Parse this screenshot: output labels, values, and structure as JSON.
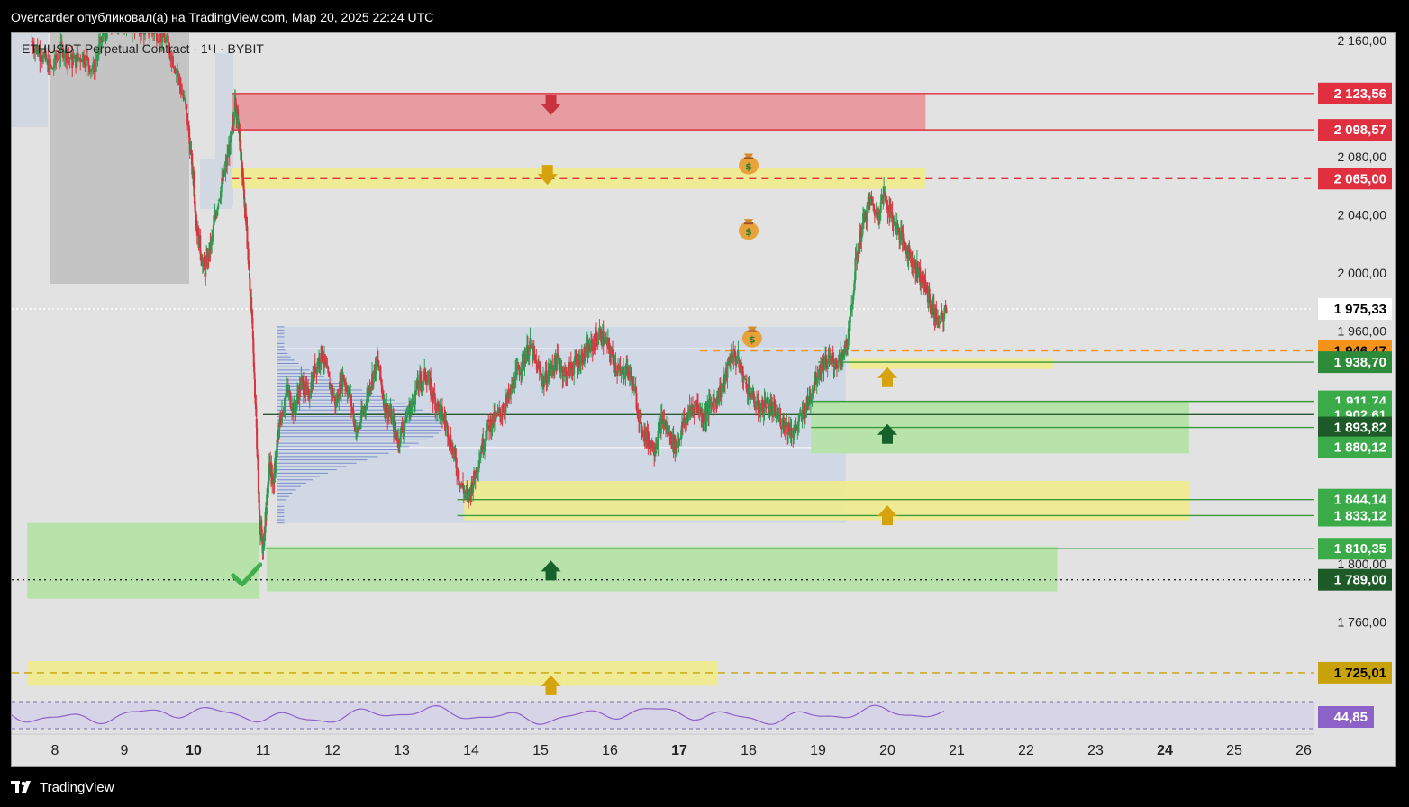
{
  "header": {
    "published_text": "Overcarder опубликовал(а) на TradingView.com, Мар 20, 2025 22:24 UTC"
  },
  "symbol": {
    "title": "ETHUSDT Perpetual Contract · 1Ч · BYBIT"
  },
  "footer": {
    "brand": "TradingView"
  },
  "colors": {
    "background": "#e2e2e2",
    "resistance_zone": "#e8959b",
    "resistance_line": "#e03040",
    "yellow_zone": "#f0ec8c",
    "green_zone": "#b2e3a4",
    "green_line": "#3a9a3c",
    "candle_up": "#2e9a52",
    "candle_down": "#d6343e",
    "rsi_line": "#8d62c8",
    "arrow_red": "#c8333f",
    "arrow_yellow": "#d4a30e",
    "arrow_green": "#17622a"
  },
  "chart_data": {
    "type": "candlestick",
    "symbol": "ETHUSDT Perpetual Contract",
    "timeframe": "1Ч",
    "exchange": "BYBIT",
    "x_ticks": [
      "8",
      "9",
      "10",
      "11",
      "12",
      "13",
      "14",
      "15",
      "16",
      "17",
      "18",
      "19",
      "20",
      "21",
      "22",
      "23",
      "24",
      "25",
      "26"
    ],
    "bold_x_ticks": [
      "10",
      "17",
      "24"
    ],
    "ylim": [
      1700,
      2180
    ],
    "y_ticks": [
      {
        "value": 2160,
        "label": "2 160,00"
      },
      {
        "value": 2080,
        "label": "2 080,00"
      },
      {
        "value": 2040,
        "label": "2 040,00"
      },
      {
        "value": 2000,
        "label": "2 000,00"
      },
      {
        "value": 1960,
        "label": "1 960,00"
      },
      {
        "value": 1800,
        "label": "1 800,00"
      },
      {
        "value": 1760,
        "label": "1 760,00"
      }
    ],
    "price_labels": [
      {
        "value": 2123.56,
        "label": "2 123,56",
        "bg": "#e03040",
        "fg": "#ffffff"
      },
      {
        "value": 2098.57,
        "label": "2 098,57",
        "bg": "#e03040",
        "fg": "#ffffff"
      },
      {
        "value": 2065.0,
        "label": "2 065,00",
        "bg": "#e03040",
        "fg": "#ffffff"
      },
      {
        "value": 1975.33,
        "label": "1 975,33",
        "bg": "#ffffff",
        "fg": "#000000"
      },
      {
        "value": 1946.47,
        "label": "1 946,47",
        "bg": "#f7931a",
        "fg": "#000000"
      },
      {
        "value": 1938.7,
        "label": "1 938,70",
        "bg": "#2e8b3a",
        "fg": "#ffffff"
      },
      {
        "value": 1911.74,
        "label": "1 911,74",
        "bg": "#3aab48",
        "fg": "#ffffff"
      },
      {
        "value": 1902.61,
        "label": "1 902,61",
        "bg": "#3aab48",
        "fg": "#ffffff"
      },
      {
        "value": 1893.82,
        "label": "1 893,82",
        "bg": "#1d5a27",
        "fg": "#ffffff"
      },
      {
        "value": 1880.12,
        "label": "1 880,12",
        "bg": "#3aab48",
        "fg": "#ffffff"
      },
      {
        "value": 1844.14,
        "label": "1 844,14",
        "bg": "#3aab48",
        "fg": "#ffffff"
      },
      {
        "value": 1833.12,
        "label": "1 833,12",
        "bg": "#3aab48",
        "fg": "#ffffff"
      },
      {
        "value": 1810.35,
        "label": "1 810,35",
        "bg": "#3aab48",
        "fg": "#ffffff"
      },
      {
        "value": 1789.0,
        "label": "1 789,00",
        "bg": "#1d5a27",
        "fg": "#ffffff"
      },
      {
        "value": 1725.01,
        "label": "1 725,01",
        "bg": "#c9a20a",
        "fg": "#000000"
      }
    ],
    "zones": [
      {
        "type": "resistance",
        "from_day": 10.55,
        "to_day": 20.55,
        "low": 2098.57,
        "high": 2123.56
      },
      {
        "type": "yellow",
        "from_day": 10.55,
        "to_day": 20.55,
        "low": 2058,
        "high": 2072
      },
      {
        "type": "yellow",
        "from_day": 19.45,
        "to_day": 22.4,
        "low": 1934,
        "high": 1941
      },
      {
        "type": "green",
        "from_day": 18.9,
        "to_day": 24.35,
        "low": 1876,
        "high": 1911.74
      },
      {
        "type": "yellow",
        "from_day": 13.9,
        "to_day": 24.35,
        "low": 1830,
        "high": 1857
      },
      {
        "type": "green",
        "from_day": 11.05,
        "to_day": 22.45,
        "low": 1781,
        "high": 1812
      },
      {
        "type": "green",
        "from_day": 7.6,
        "to_day": 10.95,
        "low": 1776,
        "high": 1828
      },
      {
        "type": "yellow",
        "from_day": 7.6,
        "to_day": 17.55,
        "low": 1716,
        "high": 1733
      }
    ],
    "volume_profile": {
      "from_day": 11.2,
      "to_day": 19.4,
      "low": 1828,
      "high": 1963
    },
    "rsi": {
      "last_value": 44.85,
      "label": "44,85"
    },
    "price_series": [
      [
        7.65,
        2160
      ],
      [
        7.8,
        2150
      ],
      [
        7.95,
        2140
      ],
      [
        8.1,
        2155
      ],
      [
        8.25,
        2145
      ],
      [
        8.4,
        2150
      ],
      [
        8.55,
        2140
      ],
      [
        8.7,
        2165
      ],
      [
        8.85,
        2172
      ],
      [
        9.0,
        2175
      ],
      [
        9.15,
        2170
      ],
      [
        9.3,
        2168
      ],
      [
        9.45,
        2166
      ],
      [
        9.6,
        2160
      ],
      [
        9.75,
        2140
      ],
      [
        9.9,
        2110
      ],
      [
        10.0,
        2060
      ],
      [
        10.05,
        2030
      ],
      [
        10.15,
        2000
      ],
      [
        10.25,
        2020
      ],
      [
        10.35,
        2050
      ],
      [
        10.45,
        2070
      ],
      [
        10.55,
        2095
      ],
      [
        10.6,
        2120
      ],
      [
        10.65,
        2100
      ],
      [
        10.7,
        2070
      ],
      [
        10.75,
        2040
      ],
      [
        10.8,
        2000
      ],
      [
        10.85,
        1960
      ],
      [
        10.9,
        1900
      ],
      [
        10.95,
        1830
      ],
      [
        11.0,
        1810
      ],
      [
        11.05,
        1840
      ],
      [
        11.1,
        1870
      ],
      [
        11.15,
        1855
      ],
      [
        11.2,
        1880
      ],
      [
        11.25,
        1900
      ],
      [
        11.35,
        1920
      ],
      [
        11.45,
        1905
      ],
      [
        11.55,
        1925
      ],
      [
        11.65,
        1915
      ],
      [
        11.75,
        1935
      ],
      [
        11.85,
        1945
      ],
      [
        11.95,
        1925
      ],
      [
        12.05,
        1910
      ],
      [
        12.15,
        1930
      ],
      [
        12.25,
        1915
      ],
      [
        12.35,
        1890
      ],
      [
        12.45,
        1905
      ],
      [
        12.55,
        1925
      ],
      [
        12.65,
        1940
      ],
      [
        12.75,
        1910
      ],
      [
        12.85,
        1900
      ],
      [
        12.95,
        1885
      ],
      [
        13.05,
        1900
      ],
      [
        13.15,
        1910
      ],
      [
        13.25,
        1925
      ],
      [
        13.35,
        1930
      ],
      [
        13.45,
        1915
      ],
      [
        13.55,
        1905
      ],
      [
        13.65,
        1895
      ],
      [
        13.75,
        1875
      ],
      [
        13.85,
        1855
      ],
      [
        13.95,
        1845
      ],
      [
        14.05,
        1860
      ],
      [
        14.15,
        1880
      ],
      [
        14.25,
        1895
      ],
      [
        14.35,
        1900
      ],
      [
        14.45,
        1905
      ],
      [
        14.55,
        1915
      ],
      [
        14.65,
        1930
      ],
      [
        14.75,
        1940
      ],
      [
        14.85,
        1950
      ],
      [
        14.95,
        1935
      ],
      [
        15.05,
        1925
      ],
      [
        15.15,
        1935
      ],
      [
        15.25,
        1940
      ],
      [
        15.35,
        1930
      ],
      [
        15.45,
        1935
      ],
      [
        15.55,
        1940
      ],
      [
        15.65,
        1945
      ],
      [
        15.75,
        1950
      ],
      [
        15.85,
        1958
      ],
      [
        15.95,
        1952
      ],
      [
        16.05,
        1940
      ],
      [
        16.15,
        1930
      ],
      [
        16.25,
        1935
      ],
      [
        16.35,
        1920
      ],
      [
        16.45,
        1895
      ],
      [
        16.55,
        1885
      ],
      [
        16.65,
        1880
      ],
      [
        16.75,
        1900
      ],
      [
        16.85,
        1890
      ],
      [
        16.95,
        1880
      ],
      [
        17.05,
        1895
      ],
      [
        17.15,
        1905
      ],
      [
        17.25,
        1910
      ],
      [
        17.35,
        1900
      ],
      [
        17.45,
        1910
      ],
      [
        17.55,
        1915
      ],
      [
        17.65,
        1925
      ],
      [
        17.75,
        1945
      ],
      [
        17.85,
        1940
      ],
      [
        17.95,
        1925
      ],
      [
        18.05,
        1915
      ],
      [
        18.15,
        1905
      ],
      [
        18.25,
        1910
      ],
      [
        18.35,
        1905
      ],
      [
        18.45,
        1900
      ],
      [
        18.55,
        1895
      ],
      [
        18.65,
        1890
      ],
      [
        18.75,
        1900
      ],
      [
        18.85,
        1910
      ],
      [
        18.95,
        1925
      ],
      [
        19.05,
        1938
      ],
      [
        19.15,
        1940
      ],
      [
        19.25,
        1938
      ],
      [
        19.35,
        1940
      ],
      [
        19.45,
        1960
      ],
      [
        19.55,
        2010
      ],
      [
        19.65,
        2035
      ],
      [
        19.75,
        2050
      ],
      [
        19.85,
        2040
      ],
      [
        19.95,
        2055
      ],
      [
        20.05,
        2040
      ],
      [
        20.15,
        2030
      ],
      [
        20.25,
        2020
      ],
      [
        20.35,
        2010
      ],
      [
        20.45,
        2000
      ],
      [
        20.55,
        1990
      ],
      [
        20.65,
        1975
      ],
      [
        20.75,
        1965
      ],
      [
        20.85,
        1975
      ]
    ]
  }
}
